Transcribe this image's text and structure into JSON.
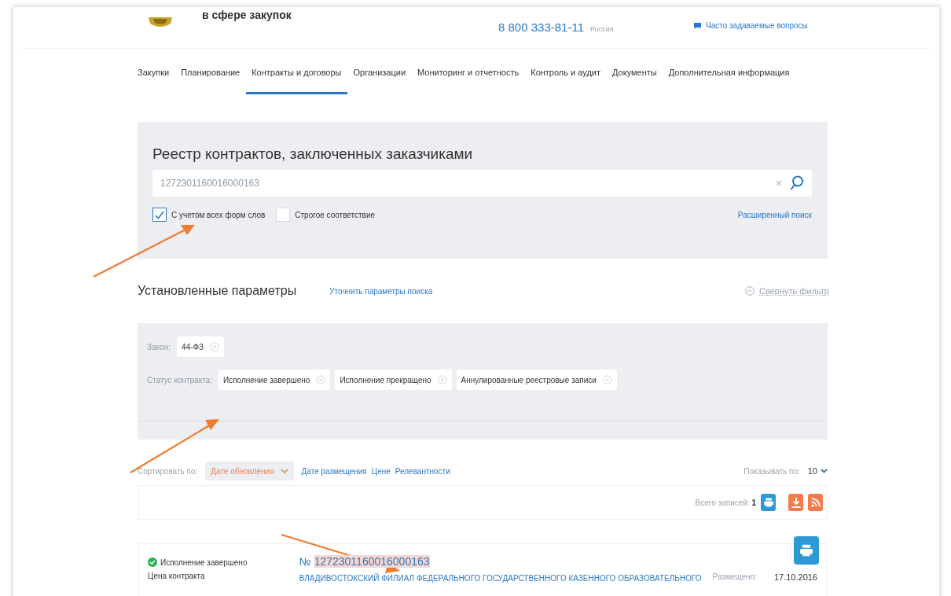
{
  "header": {
    "title": "в сфере закупок",
    "phone": "8 800 333-81-11",
    "region": "Россия",
    "faq": "Часто задаваемые вопросы"
  },
  "nav": [
    {
      "label": "Закупки",
      "selected": false
    },
    {
      "label": "Планирование",
      "selected": false
    },
    {
      "label": "Контракты и договоры",
      "selected": true
    },
    {
      "label": "Организации",
      "selected": false
    },
    {
      "label": "Мониторинг и отчетность",
      "selected": false
    },
    {
      "label": "Контроль и аудит",
      "selected": false
    },
    {
      "label": "Документы",
      "selected": false
    },
    {
      "label": "Дополнительная информация",
      "selected": false
    }
  ],
  "search": {
    "title": "Реестр контрактов, заключенных заказчиками",
    "value": "1272301160016000163",
    "options": [
      {
        "label": "С учетом всех форм слов",
        "checked": true
      },
      {
        "label": "Строгое соответствие",
        "checked": false
      }
    ],
    "advanced_link": "Расширенный поиск"
  },
  "params": {
    "title": "Установленные параметры",
    "refine_link": "Уточнить параметры поиска",
    "collapse_link": "Свернуть фильтр",
    "groups": [
      {
        "label": "Закон:",
        "tags": [
          "44-ФЗ"
        ]
      },
      {
        "label": "Статус контракта:",
        "tags": [
          "Исполнение завершено",
          "Исполнение прекращено",
          "Аннулированные реестровые записи"
        ]
      }
    ]
  },
  "sort": {
    "label": "Сортировать по:",
    "options": [
      {
        "label": "Дате обновления",
        "selected": true
      },
      {
        "label": "Дате размещения",
        "selected": false
      },
      {
        "label": "Цене",
        "selected": false
      },
      {
        "label": "Релевантности",
        "selected": false
      }
    ],
    "page_size_label": "Показывать по:",
    "page_size": "10"
  },
  "totals": {
    "label": "Всего записей:",
    "count": "1"
  },
  "results": [
    {
      "status": "Исполнение завершено",
      "price_label": "Цена контракта",
      "number_prefix": "№",
      "number": "1272301160016000163",
      "highlighted": true,
      "customer": "ВЛАДИВОСТОКСКИЙ ФИЛИАЛ ФЕДЕРАЛЬНОГО ГОСУДАРСТВЕННОГО КАЗЕННОГО ОБРАЗОВАТЕЛЬНОГО",
      "posted_label": "Размещено:",
      "posted_date": "17.10.2016"
    }
  ]
}
